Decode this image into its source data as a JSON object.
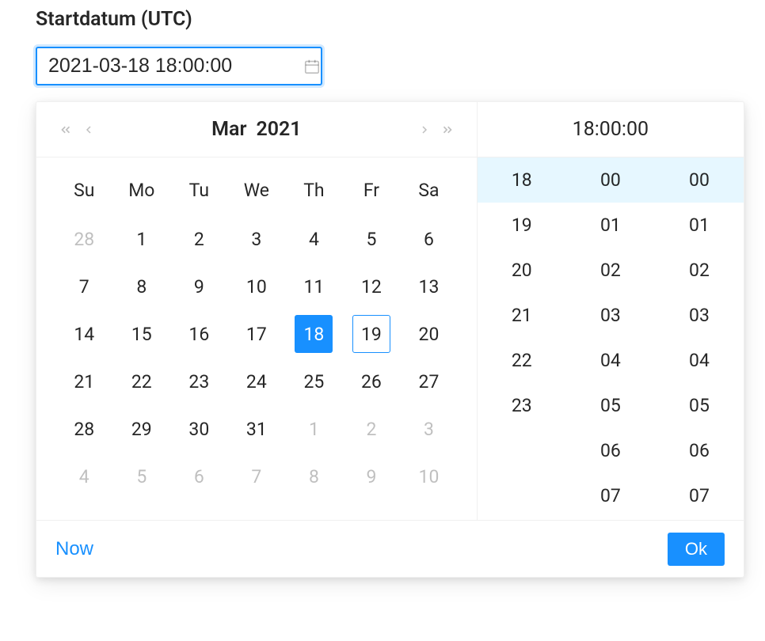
{
  "field": {
    "label": "Startdatum (UTC)",
    "value": "2021-03-18 18:00:00"
  },
  "calendar": {
    "month_label": "Mar",
    "year_label": "2021",
    "weekdays": [
      "Su",
      "Mo",
      "Tu",
      "We",
      "Th",
      "Fr",
      "Sa"
    ],
    "weeks": [
      [
        {
          "d": "28",
          "other": true
        },
        {
          "d": "1"
        },
        {
          "d": "2"
        },
        {
          "d": "3"
        },
        {
          "d": "4"
        },
        {
          "d": "5"
        },
        {
          "d": "6"
        }
      ],
      [
        {
          "d": "7"
        },
        {
          "d": "8"
        },
        {
          "d": "9"
        },
        {
          "d": "10"
        },
        {
          "d": "11"
        },
        {
          "d": "12"
        },
        {
          "d": "13"
        }
      ],
      [
        {
          "d": "14"
        },
        {
          "d": "15"
        },
        {
          "d": "16"
        },
        {
          "d": "17"
        },
        {
          "d": "18",
          "selected": true
        },
        {
          "d": "19",
          "today": true
        },
        {
          "d": "20"
        }
      ],
      [
        {
          "d": "21"
        },
        {
          "d": "22"
        },
        {
          "d": "23"
        },
        {
          "d": "24"
        },
        {
          "d": "25"
        },
        {
          "d": "26"
        },
        {
          "d": "27"
        }
      ],
      [
        {
          "d": "28"
        },
        {
          "d": "29"
        },
        {
          "d": "30"
        },
        {
          "d": "31"
        },
        {
          "d": "1",
          "other": true
        },
        {
          "d": "2",
          "other": true
        },
        {
          "d": "3",
          "other": true
        }
      ],
      [
        {
          "d": "4",
          "other": true
        },
        {
          "d": "5",
          "other": true
        },
        {
          "d": "6",
          "other": true
        },
        {
          "d": "7",
          "other": true
        },
        {
          "d": "8",
          "other": true
        },
        {
          "d": "9",
          "other": true
        },
        {
          "d": "10",
          "other": true
        }
      ]
    ]
  },
  "time": {
    "display": "18:00:00",
    "hours": [
      "18",
      "19",
      "20",
      "21",
      "22",
      "23"
    ],
    "minutes": [
      "00",
      "01",
      "02",
      "03",
      "04",
      "05",
      "06",
      "07"
    ],
    "seconds": [
      "00",
      "01",
      "02",
      "03",
      "04",
      "05",
      "06",
      "07"
    ],
    "selected_hour": "18",
    "selected_minute": "00",
    "selected_second": "00"
  },
  "footer": {
    "now_label": "Now",
    "ok_label": "Ok"
  }
}
